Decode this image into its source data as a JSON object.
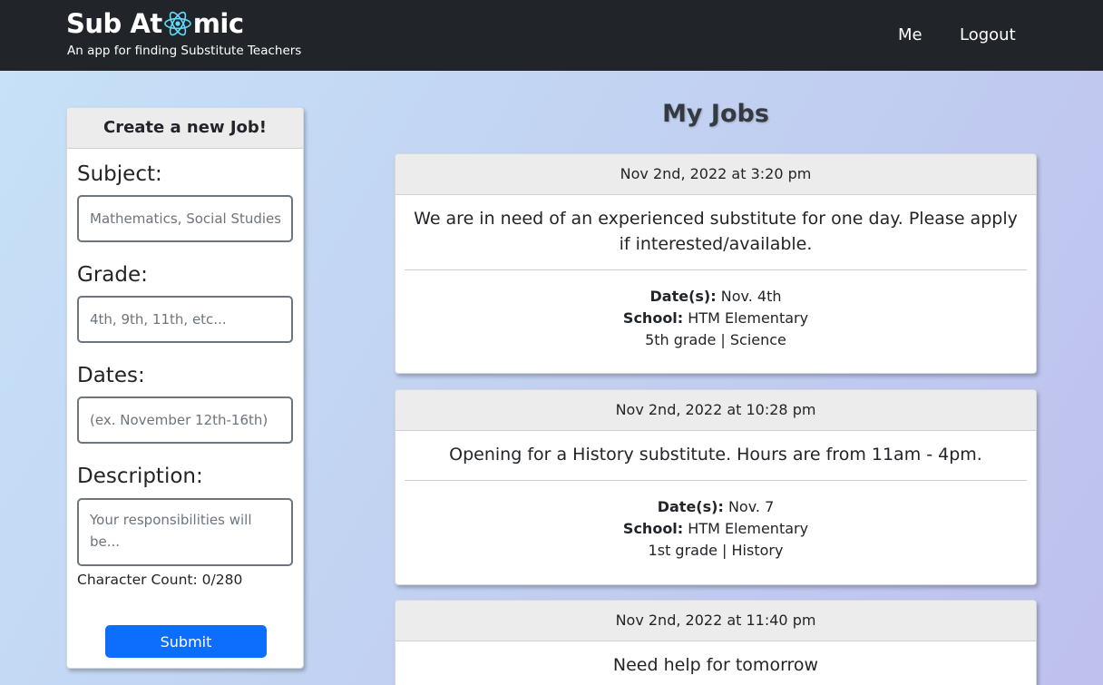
{
  "navbar": {
    "brand_prefix": "Sub At",
    "brand_suffix": "mic",
    "brand_icon": "atom-icon",
    "subtitle": "An app for finding Substitute Teachers",
    "links": {
      "me": "Me",
      "logout": "Logout"
    }
  },
  "form": {
    "title": "Create a new Job!",
    "subject": {
      "label": "Subject:",
      "placeholder": "Mathematics, Social Studies"
    },
    "grade": {
      "label": "Grade:",
      "placeholder": "4th, 9th, 11th, etc..."
    },
    "dates": {
      "label": "Dates:",
      "placeholder": "(ex. November 12th-16th)"
    },
    "description": {
      "label": "Description:",
      "placeholder": "Your responsibilities will be..."
    },
    "char_count": "Character Count: 0/280",
    "submit_label": "Submit"
  },
  "jobs": {
    "title": "My Jobs",
    "dates_label": "Date(s):",
    "school_label": "School:",
    "items": [
      {
        "posted": "Nov 2nd, 2022 at 3:20 pm",
        "description": "We are in need of an experienced substitute for one day. Please apply if interested/available.",
        "dates": "Nov. 4th",
        "school": "HTM Elementary",
        "grade_subject": "5th grade | Science"
      },
      {
        "posted": "Nov 2nd, 2022 at 10:28 pm",
        "description": "Opening for a History substitute. Hours are from 11am - 4pm.",
        "dates": "Nov. 7",
        "school": "HTM Elementary",
        "grade_subject": "1st grade | History"
      },
      {
        "posted": "Nov 2nd, 2022 at 11:40 pm",
        "description": "Need help for tomorrow"
      }
    ]
  },
  "colors": {
    "navbar": "#212529",
    "atom_icon": "#61dafb",
    "submit_button": "#0d6efd"
  }
}
